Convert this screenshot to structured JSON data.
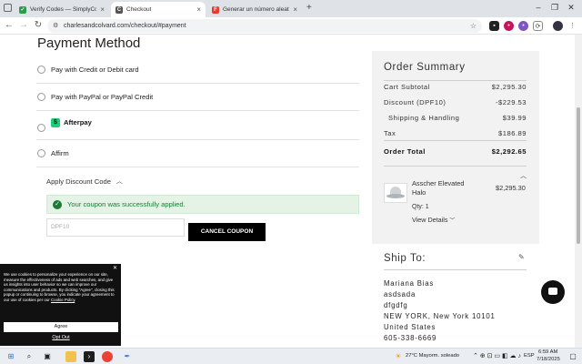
{
  "browser": {
    "tabs": [
      {
        "title": "Verify Codes — SimplyCodes",
        "favicon_color": "#2a9d4b",
        "favicon_glyph": "✓"
      },
      {
        "title": "Checkout",
        "favicon_color": "#555555",
        "favicon_glyph": "C",
        "active": true
      },
      {
        "title": "Generar un número aleatorio -",
        "favicon_color": "#e63b2e",
        "favicon_glyph": "F"
      }
    ],
    "new_tab": "+",
    "url": "charlesandcolvard.com/checkout/#payment"
  },
  "payment": {
    "heading": "Payment Method",
    "options": [
      {
        "label": "Pay with Credit or Debit card"
      },
      {
        "label": "Pay with PayPal or PayPal Credit"
      },
      {
        "label": "Afterpay",
        "logo": "$"
      },
      {
        "label": "Affirm"
      }
    ],
    "discount_toggle": "Apply Discount Code",
    "success_message": "Your coupon was successfully applied.",
    "coupon_value": "DPF10",
    "cancel_button": "CANCEL COUPON"
  },
  "summary": {
    "title": "Order Summary",
    "rows": [
      {
        "label": "Cart Subtotal",
        "value": "$2,295.30"
      },
      {
        "label": "Discount (DPF10)",
        "value": "-$229.53"
      },
      {
        "label": "Shipping & Handling",
        "value": "$39.99"
      },
      {
        "label": "Tax",
        "value": "$186.89"
      }
    ],
    "total_label": "Order Total",
    "total_value": "$2,292.65",
    "product": {
      "name": "Asscher Elevated Halo",
      "price": "$2,295.30",
      "qty": "Qty: 1",
      "view_details": "View Details"
    }
  },
  "ship": {
    "title": "Ship To:",
    "lines": [
      "Mariana Bias",
      "asdsada",
      "dfgdfg",
      "NEW YORK, New York 10101",
      "United States",
      "605-338-6669"
    ]
  },
  "cookie": {
    "text": "We use cookies to personalize your experience on our site, measure the effectiveness of ads and web searches, and give us insights into user behavior so we can improve our communications and products. By clicking \"Agree\", closing this popup or continuing to browse, you indicate your agreement to our use of cookies per our",
    "policy_link": "Cookie Policy",
    "agree": "Agree",
    "opt_out": "Opt Out"
  },
  "taskbar": {
    "weather": "27°C  Mayorm. soleado",
    "language": "ESP",
    "time": "6:59 AM",
    "date": "7/18/2025"
  }
}
